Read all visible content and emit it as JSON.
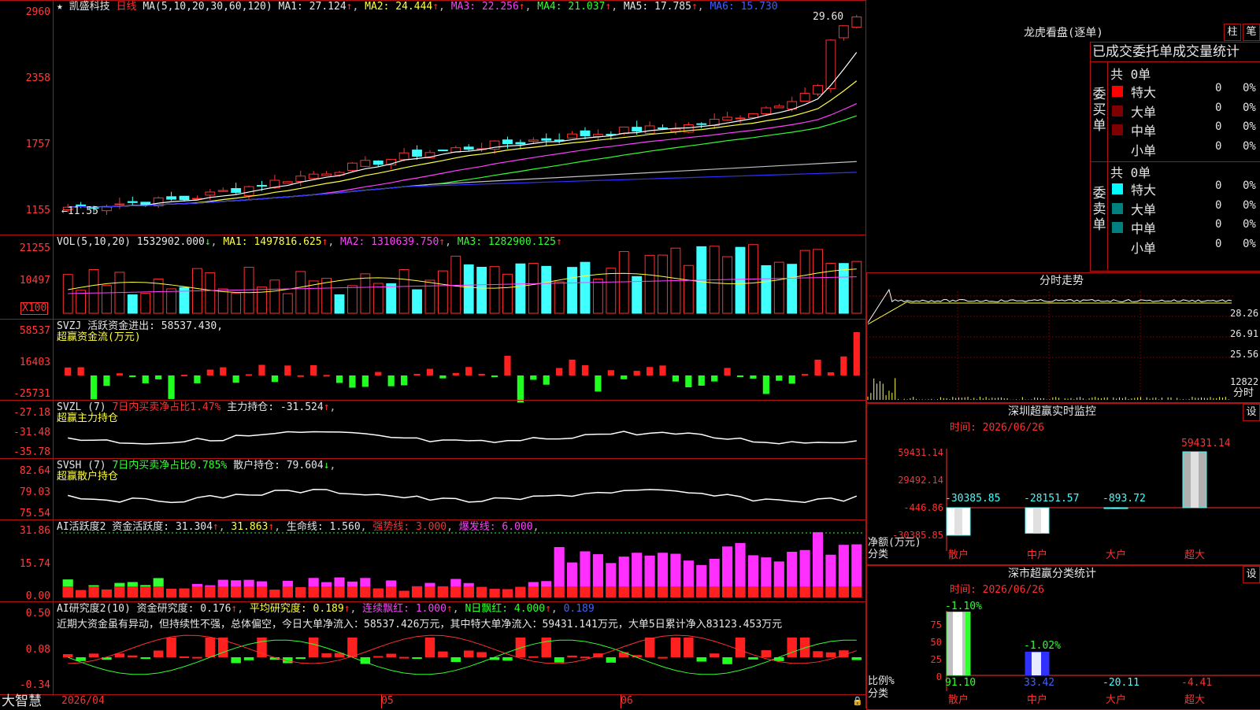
{
  "main": {
    "stock_name": "凯盛科技",
    "period": "日线",
    "ma_params": "MA(5,10,20,30,60,120)",
    "ma1": "MA1: 27.124",
    "ma2": "MA2: 24.444",
    "ma3": "MA3: 22.256",
    "ma4": "MA4: 21.037",
    "ma5": "MA5: 17.785",
    "ma6": "MA6: 15.730",
    "y_ticks": [
      "2960",
      "2358",
      "1757",
      "1155"
    ],
    "high_label": "29.60",
    "low_label": "11.55"
  },
  "vol": {
    "title": "VOL(5,10,20)",
    "value": "1532902.000",
    "ma1": "MA1: 1497816.625",
    "ma2": "MA2: 1310639.750",
    "ma3": "MA3: 1282900.125",
    "y_ticks": [
      "21255",
      "10497"
    ],
    "unit": "X100"
  },
  "svzj": {
    "title": "SVZJ",
    "line1": "活跃资金进出: 58537.430",
    "line2": "超赢资金流(万元)",
    "y_ticks": [
      "58537",
      "16403",
      "-25731"
    ]
  },
  "svzl": {
    "title": "SVZL (7)",
    "seg1": "7日内买卖净占比1.47%",
    "seg2": "主力持仓: -31.524",
    "line2": "超赢主力持仓",
    "y_ticks": [
      "-27.18",
      "-31.48",
      "-35.78"
    ]
  },
  "svsh": {
    "title": "SVSH (7)",
    "seg1": "7日内买卖净占比0.785%",
    "seg2": "散户持仓: 79.604",
    "line2": "超赢散户持仓",
    "y_ticks": [
      "82.64",
      "79.03",
      "75.54"
    ]
  },
  "ai1": {
    "title": "AI活跃度2 资金活跃度: 31.304",
    "v2": "31.863",
    "v3": "生命线: 1.560",
    "v4": "强势线: 3.000",
    "v5": "爆发线: 6.000",
    "y_ticks": [
      "31.86",
      "15.74",
      "0.00"
    ]
  },
  "ai2": {
    "title": "AI研究度2(10) 资金研究度: 0.176",
    "v2": "平均研究度: 0.189",
    "v3": "连续飘红: 1.000",
    "v4": "N日飘红: 4.000",
    "v5": "0.189",
    "note": "近期大资金虽有异动，但持续性不强，总体偏空，今日大单净流入：58537.426万元，其中特大单净流入：59431.141万元，大单5日累计净入83123.453万元",
    "y_ticks": [
      "0.50",
      "0.08",
      "-0.34"
    ]
  },
  "bottom": {
    "brand": "大智慧",
    "dates": [
      "2026/04",
      "05",
      "06"
    ]
  },
  "right": {
    "lh_title": "龙虎看盘(逐单)",
    "btn_zhu": "柱",
    "btn_bi": "笔",
    "tab1": "已成交",
    "tab2": "委托单",
    "tab3": "成交量统计",
    "buy_label": "委买单",
    "sell_label": "委卖单",
    "buy_total": "共 0单",
    "sell_total": "共 0单",
    "rows": [
      {
        "name": "特大",
        "n": "0",
        "p": "0%"
      },
      {
        "name": "大单",
        "n": "0",
        "p": "0%"
      },
      {
        "name": "中单",
        "n": "0",
        "p": "0%"
      },
      {
        "name": "小单",
        "n": "0",
        "p": "0%"
      }
    ],
    "colors": {
      "buy": [
        "#ff0000",
        "#800000",
        "#800000"
      ],
      "sell": [
        "#00ffff",
        "#008080",
        "#008080"
      ]
    },
    "fs_title": "分时走势",
    "fs_ticks": [
      "28.26",
      "26.91",
      "25.56"
    ],
    "fs_vol": "12822",
    "fs_fen": "分时",
    "sz_title": "深圳超赢实时监控",
    "sz_btn": "设",
    "sz_time": "时间: 2026/06/26",
    "sz_ticks": [
      "59431.14",
      "29492.14",
      "-446.86",
      "-30385.85"
    ],
    "sz_values": [
      {
        "cat": "散户",
        "label": "-30385.85",
        "v": -30385.85
      },
      {
        "cat": "中户",
        "label": "-28151.57",
        "v": -28151.57
      },
      {
        "cat": "大户",
        "label": "-893.72",
        "v": -893.72
      },
      {
        "cat": "超大",
        "label": "59431.14",
        "v": 59431.14
      }
    ],
    "sz_unit": "净额(万元)",
    "sz_cat": "分类",
    "ss_title": "深市超赢分类统计",
    "ss_btn": "设",
    "ss_time": "时间: 2026/06/26",
    "ss_ticks": [
      "75",
      "50",
      "25",
      "0"
    ],
    "ss_top": [
      "-1.10%",
      "-1.02%"
    ],
    "ss_values": [
      {
        "cat": "散户",
        "label": "91.10",
        "v": 91.1
      },
      {
        "cat": "中户",
        "label": "33.42",
        "v": 33.42
      },
      {
        "cat": "大户",
        "label": "-20.11",
        "v": -20.11
      },
      {
        "cat": "超大",
        "label": "-4.41",
        "v": -4.41
      }
    ],
    "ss_unit": "比例%",
    "ss_cat": "分类"
  }
}
